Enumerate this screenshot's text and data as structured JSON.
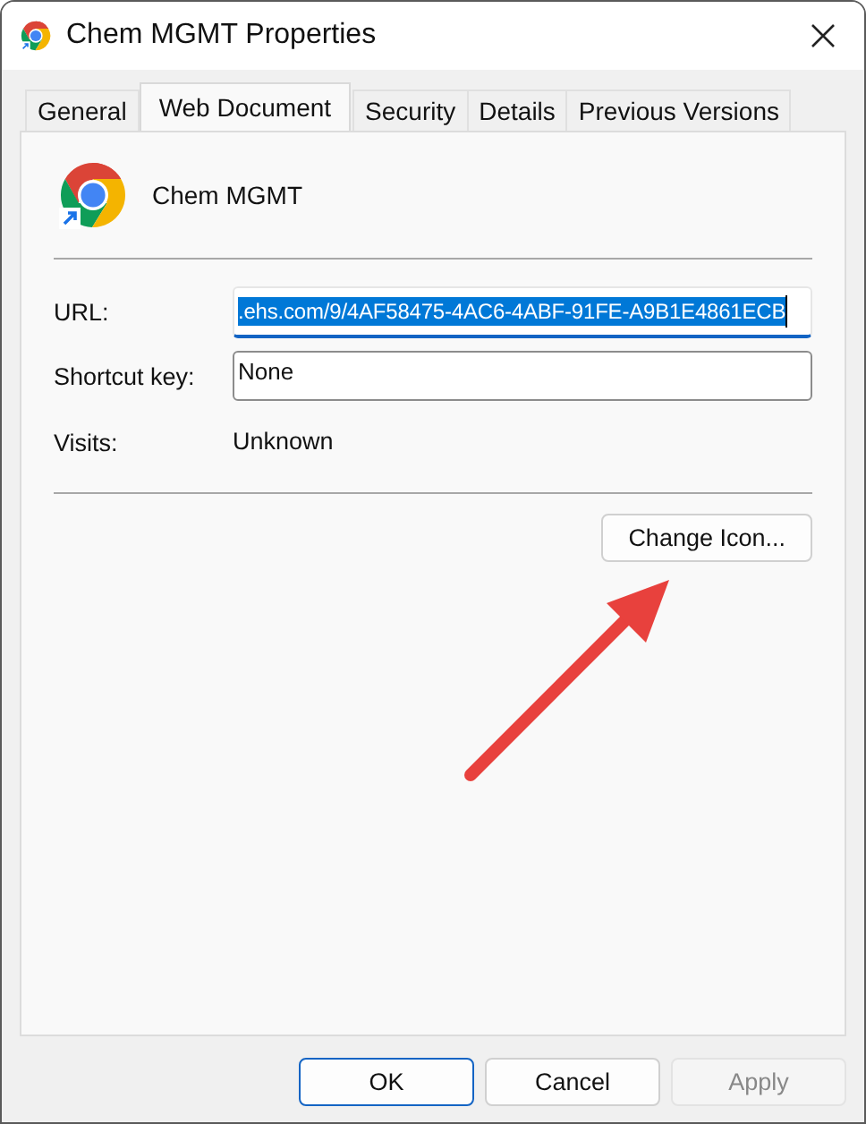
{
  "window": {
    "title": "Chem MGMT Properties"
  },
  "tabs": [
    {
      "label": "General",
      "selected": false
    },
    {
      "label": "Web Document",
      "selected": true
    },
    {
      "label": "Security",
      "selected": false
    },
    {
      "label": "Details",
      "selected": false
    },
    {
      "label": "Previous Versions",
      "selected": false
    }
  ],
  "shortcut_name": "Chem MGMT",
  "fields": [
    {
      "kind": "input",
      "label": "URL:",
      "value": ".ehs.com/9/4AF58475-4AC6-4ABF-91FE-A9B1E4861ECB",
      "focused": true,
      "text_selected": true
    },
    {
      "kind": "input",
      "label": "Shortcut key:",
      "value": "None",
      "focused": false,
      "text_selected": false
    },
    {
      "kind": "static",
      "label": "Visits:",
      "value": "Unknown"
    }
  ],
  "change_icon_button": {
    "label": "Change Icon..."
  },
  "annotation": {
    "kind": "arrow"
  },
  "buttons": [
    {
      "label": "OK",
      "default": true,
      "disabled": false
    },
    {
      "label": "Cancel",
      "default": false,
      "disabled": false
    },
    {
      "label": "Apply",
      "default": false,
      "disabled": true
    }
  ]
}
